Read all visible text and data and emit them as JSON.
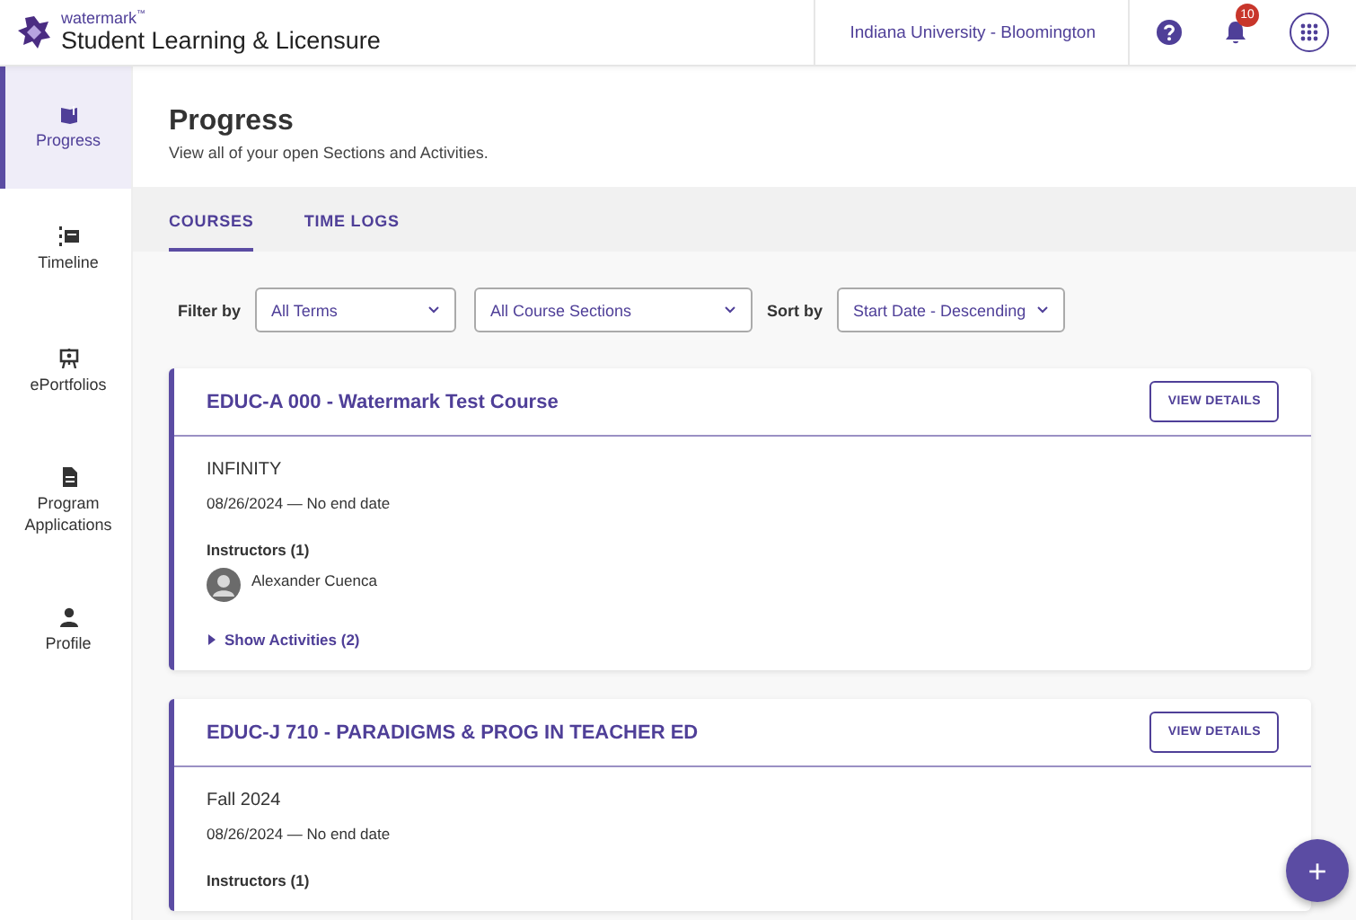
{
  "header": {
    "brand_small": "watermark",
    "brand_mark": "™",
    "app_name": "Student Learning & Licensure",
    "organization": "Indiana University - Bloomington",
    "notification_count": "10"
  },
  "sidebar": {
    "items": [
      {
        "label": "Progress",
        "selected": true
      },
      {
        "label": "Timeline",
        "selected": false
      },
      {
        "label": "ePortfolios",
        "selected": false
      },
      {
        "label": "Program Applications",
        "selected": false
      },
      {
        "label": "Profile",
        "selected": false
      }
    ]
  },
  "page": {
    "title": "Progress",
    "subtitle": "View all of your open Sections and Activities."
  },
  "tabs": [
    {
      "label": "COURSES",
      "selected": true
    },
    {
      "label": "TIME LOGS",
      "selected": false
    }
  ],
  "filters": {
    "filter_label": "Filter by",
    "term_select": "All Terms",
    "section_select": "All Course Sections",
    "sort_label": "Sort by",
    "sort_select": "Start Date - Descending"
  },
  "courses": [
    {
      "title": "EDUC-A 000 - Watermark Test Course",
      "button": "VIEW DETAILS",
      "term": "INFINITY",
      "dates": "08/26/2024 — No end date",
      "instructors_label": "Instructors (1)",
      "instructors": [
        "Alexander Cuenca"
      ],
      "activities_toggle": "Show Activities (2)",
      "activities_expanded": false
    },
    {
      "title": "EDUC-J 710 - PARADIGMS & PROG IN TEACHER ED",
      "button": "VIEW DETAILS",
      "term": "Fall 2024",
      "dates": "08/26/2024 — No end date",
      "instructors_label": "Instructors (1)"
    }
  ],
  "fab": {
    "label": "+"
  }
}
